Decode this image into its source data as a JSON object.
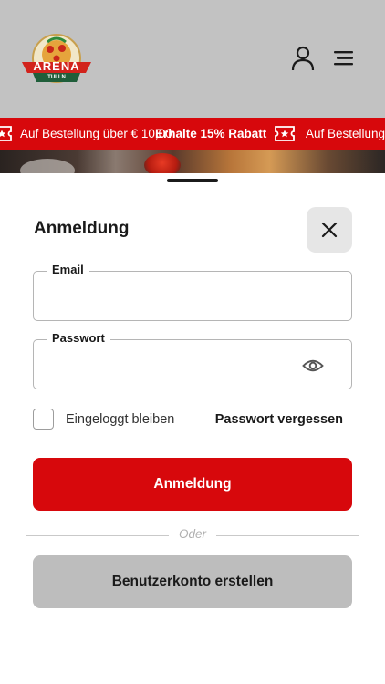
{
  "header": {
    "logo_text": "ARENA",
    "logo_subtext": "TULLN",
    "icons": [
      "user-icon",
      "menu-icon"
    ]
  },
  "promo": {
    "text_1": "Auf Bestellung über € 10,00",
    "text_2": "Erhalte 15% Rabatt",
    "text_3": "Auf Bestellung",
    "icon": "ticket-star-icon"
  },
  "login": {
    "title": "Anmeldung",
    "email_label": "Email",
    "email_value": "",
    "password_label": "Passwort",
    "password_value": "",
    "remember_label": "Eingeloggt bleiben",
    "forgot_label": "Passwort vergessen",
    "submit_label": "Anmeldung",
    "divider_text": "Oder",
    "register_label": "Benutzerkonto erstellen"
  },
  "colors": {
    "accent": "#d7080c",
    "header_bg": "#c2c2c2",
    "secondary_button": "#bdbdbd"
  }
}
